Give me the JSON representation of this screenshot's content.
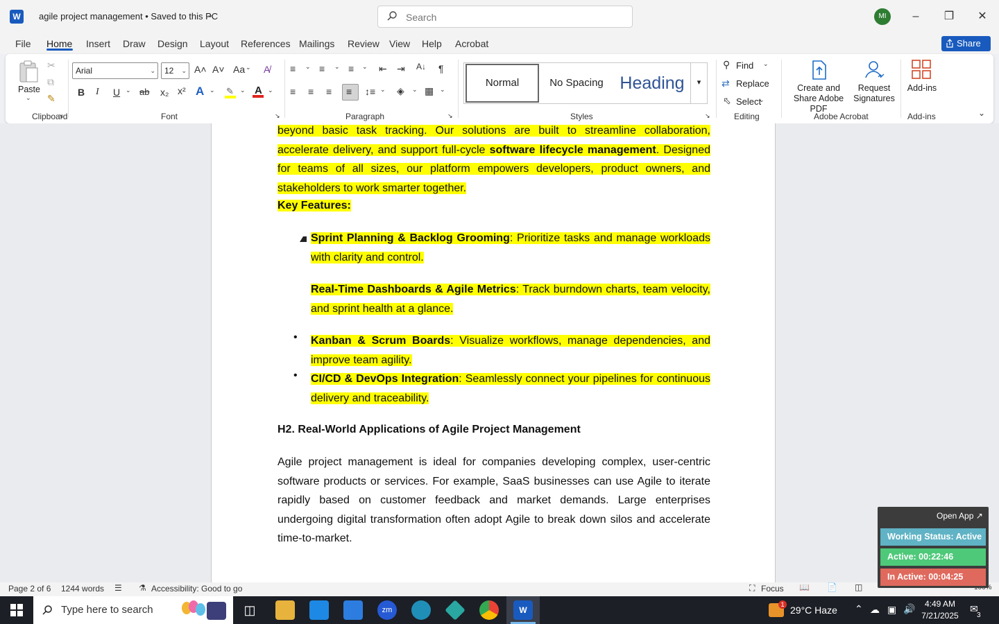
{
  "titlebar": {
    "doc_title": "agile project management • Saved to this PC",
    "search_placeholder": "Search",
    "avatar_initials": "MI"
  },
  "tabs": [
    "File",
    "Home",
    "Insert",
    "Draw",
    "Design",
    "Layout",
    "References",
    "Mailings",
    "Review",
    "View",
    "Help",
    "Acrobat"
  ],
  "share_label": "Share",
  "ribbon": {
    "clipboard": {
      "paste": "Paste",
      "group": "Clipboard"
    },
    "font": {
      "name": "Arial",
      "size": "12",
      "group": "Font",
      "grow": "A˄",
      "shrink": "A˅",
      "case": "Aa",
      "bold": "B",
      "italic": "I",
      "underline": "U",
      "strike": "ab",
      "sub": "x₂",
      "sup": "x²"
    },
    "paragraph": {
      "group": "Paragraph",
      "pilcrow": "¶"
    },
    "styles": {
      "normal": "Normal",
      "no_spacing": "No Spacing",
      "heading": "Heading",
      "group": "Styles"
    },
    "editing": {
      "find": "Find",
      "replace": "Replace",
      "select": "Select",
      "group": "Editing"
    },
    "acrobat": {
      "create": "Create and Share Adobe PDF",
      "request": "Request Signatures",
      "group": "Adobe Acrobat"
    },
    "addins": {
      "label": "Add-ins",
      "group": "Add-ins"
    }
  },
  "document": {
    "intro_plain": "beyond basic task tracking. Our solutions are built to streamline collaboration, accelerate delivery, and support full-cycle ",
    "intro_bold": "software lifecycle management",
    "intro_rest": ". Designed for teams of all sizes, our platform empowers developers, product owners, and stakeholders to work smarter together.",
    "key_features": "Key Features:",
    "features": [
      {
        "title": "Sprint Planning & Backlog Grooming",
        "text": ": Prioritize tasks and manage workloads with clarity and control."
      },
      {
        "title": "Real-Time Dashboards & Agile Metrics",
        "text": ": Track burndown charts, team velocity, and sprint health at a glance."
      },
      {
        "title": "Kanban & Scrum Boards",
        "text": ": Visualize workflows, manage dependencies, and improve team agility."
      },
      {
        "title": "CI/CD & DevOps Integration",
        "text": ": Seamlessly connect your pipelines for continuous delivery and traceability."
      }
    ],
    "h2": "H2. Real-World Applications of Agile Project Management",
    "body": "Agile project management is ideal for companies developing complex, user-centric software products or services. For example, SaaS businesses can use Agile to iterate rapidly based on customer feedback and market demands. Large enterprises undergoing digital transformation often adopt Agile to break down silos and accelerate time-to-market."
  },
  "statusbar": {
    "page": "Page 2 of 6",
    "words": "1244 words",
    "accessibility": "Accessibility: Good to go",
    "focus": "Focus",
    "zoom": "100%"
  },
  "widget": {
    "open_app": "Open App ↗",
    "status": "Working Status: Active",
    "active": "Active: 00:22:46",
    "inactive": "In Active: 00:04:25",
    "colors": {
      "status": "#5fb3c4",
      "active": "#4ec97a",
      "inactive": "#e0695e"
    }
  },
  "taskbar": {
    "search": "Type here to search",
    "weather": "29°C  Haze",
    "weather_badge": "1",
    "time": "4:49 AM",
    "date": "7/21/2025",
    "notif_count": "3"
  }
}
